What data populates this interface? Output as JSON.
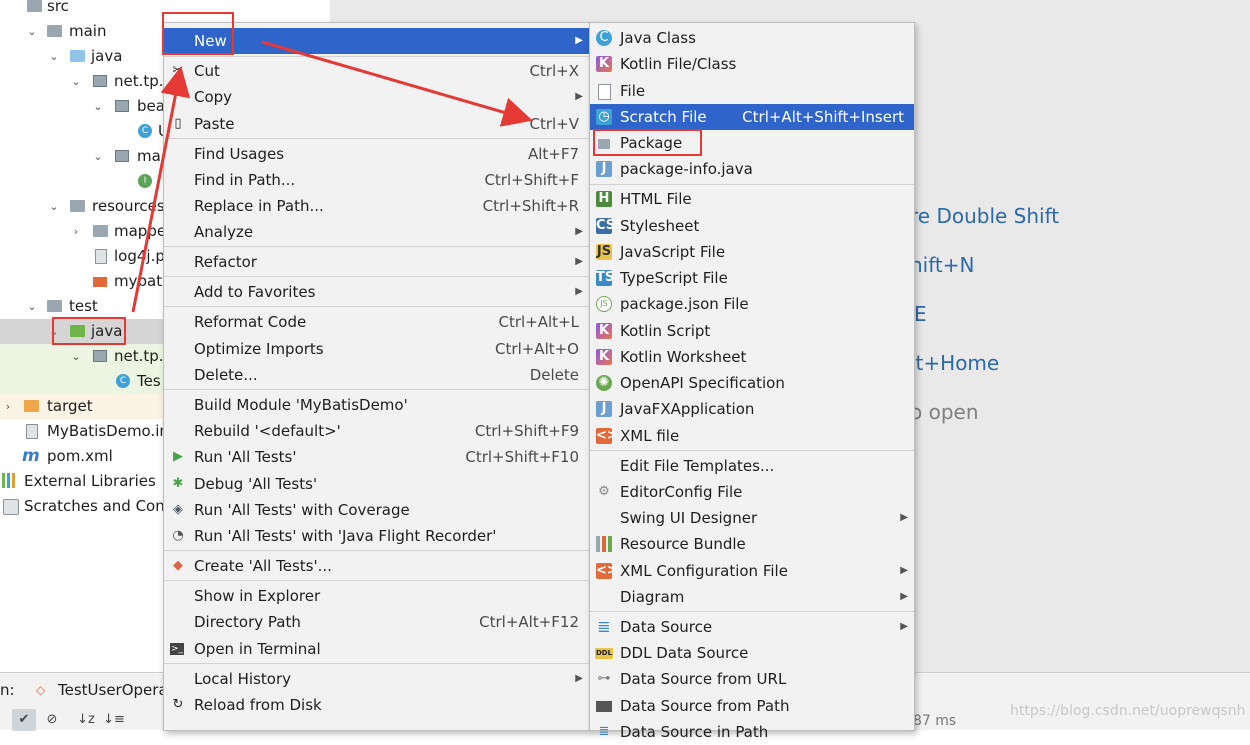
{
  "tree": {
    "rows": [
      {
        "label": "src",
        "indent": 0,
        "icon": "folder-grey",
        "chev": "⌄"
      },
      {
        "label": "main",
        "indent": 1,
        "icon": "folder-grey",
        "chev": "⌄"
      },
      {
        "label": "java",
        "indent": 2,
        "icon": "folder-blue",
        "chev": "⌄"
      },
      {
        "label": "net.tp.",
        "indent": 3,
        "icon": "pkg",
        "chev": "⌄"
      },
      {
        "label": "bea",
        "indent": 4,
        "icon": "pkg",
        "chev": "⌄"
      },
      {
        "label": "U",
        "indent": 5,
        "icon": "cls-c",
        "chev": ""
      },
      {
        "label": "ma",
        "indent": 4,
        "icon": "pkg",
        "chev": "⌄"
      },
      {
        "label": "",
        "indent": 5,
        "icon": "cls-i",
        "chev": ""
      },
      {
        "label": "resources",
        "indent": 2,
        "icon": "folder-grey",
        "chev": "⌄"
      },
      {
        "label": "mappe",
        "indent": 3,
        "icon": "folder-grey",
        "chev": "›"
      },
      {
        "label": "log4j.p",
        "indent": 3,
        "icon": "file-icon",
        "chev": ""
      },
      {
        "label": "mybati",
        "indent": 3,
        "icon": "xml-icon",
        "chev": ""
      },
      {
        "label": "test",
        "indent": 1,
        "icon": "folder-grey",
        "chev": "⌄"
      },
      {
        "label": "java",
        "indent": 2,
        "icon": "folder-green",
        "chev": "⌄"
      },
      {
        "label": "net.tp.",
        "indent": 3,
        "icon": "pkg",
        "chev": "⌄"
      },
      {
        "label": "Tes",
        "indent": 4,
        "icon": "cls-c",
        "chev": ""
      },
      {
        "label": "target",
        "indent": 0,
        "icon": "folder-orange",
        "chev": "›"
      },
      {
        "label": "MyBatisDemo.in",
        "indent": 0,
        "icon": "file-icon",
        "chev": ""
      },
      {
        "label": "pom.xml",
        "indent": 0,
        "icon": "maven",
        "chev": ""
      },
      {
        "label": "External Libraries",
        "indent": -1,
        "icon": "libs",
        "chev": ""
      },
      {
        "label": "Scratches and Cons",
        "indent": -1,
        "icon": "scratch",
        "chev": ""
      }
    ]
  },
  "editor_hints": {
    "h1": "re Double Shift",
    "h2": "hift+N",
    "h3": "E",
    "h4": "lt+Home",
    "h5": "o open"
  },
  "bottom": {
    "run_prefix": "n:",
    "run_tab": "TestUserOpera",
    "timing": "87 ms",
    "watermark": "https://blog.csdn.net/uoprewqsnh"
  },
  "context_menu": {
    "new": "New",
    "cut": "Cut",
    "cut_sc": "Ctrl+X",
    "copy": "Copy",
    "paste": "Paste",
    "paste_sc": "Ctrl+V",
    "find_usages": "Find Usages",
    "find_usages_sc": "Alt+F7",
    "find_in_path": "Find in Path...",
    "find_in_path_sc": "Ctrl+Shift+F",
    "replace_in_path": "Replace in Path...",
    "replace_in_path_sc": "Ctrl+Shift+R",
    "analyze": "Analyze",
    "refactor": "Refactor",
    "add_favorites": "Add to Favorites",
    "reformat": "Reformat Code",
    "reformat_sc": "Ctrl+Alt+L",
    "optimize": "Optimize Imports",
    "optimize_sc": "Ctrl+Alt+O",
    "delete": "Delete...",
    "delete_sc": "Delete",
    "build_module": "Build Module 'MyBatisDemo'",
    "rebuild": "Rebuild '<default>'",
    "rebuild_sc": "Ctrl+Shift+F9",
    "run_tests": "Run 'All Tests'",
    "run_tests_sc": "Ctrl+Shift+F10",
    "debug_tests": "Debug 'All Tests'",
    "run_coverage": "Run 'All Tests' with Coverage",
    "run_jfr": "Run 'All Tests' with 'Java Flight Recorder'",
    "create_tests": "Create 'All Tests'...",
    "show_explorer": "Show in Explorer",
    "directory_path": "Directory Path",
    "directory_path_sc": "Ctrl+Alt+F12",
    "open_terminal": "Open in Terminal",
    "local_history": "Local History",
    "reload": "Reload from Disk"
  },
  "submenu": {
    "java_class": "Java Class",
    "kotlin_file": "Kotlin File/Class",
    "file": "File",
    "scratch_file": "Scratch File",
    "scratch_file_sc": "Ctrl+Alt+Shift+Insert",
    "package": "Package",
    "package_info": "package-info.java",
    "html_file": "HTML File",
    "stylesheet": "Stylesheet",
    "js_file": "JavaScript File",
    "ts_file": "TypeScript File",
    "package_json": "package.json File",
    "kotlin_script": "Kotlin Script",
    "kotlin_worksheet": "Kotlin Worksheet",
    "openapi": "OpenAPI Specification",
    "javafx": "JavaFXApplication",
    "xml_file": "XML file",
    "edit_templates": "Edit File Templates...",
    "editorconfig": "EditorConfig File",
    "swing_designer": "Swing UI Designer",
    "resource_bundle": "Resource Bundle",
    "xml_config": "XML Configuration File",
    "diagram": "Diagram",
    "data_source": "Data Source",
    "ddl_data_source": "DDL Data Source",
    "ds_from_url": "Data Source from URL",
    "ds_from_path": "Data Source from Path",
    "ds_in_path": "Data Source in Path"
  },
  "colors": {
    "highlight": "#2f65ca",
    "annotation": "#e53935",
    "menu_bg": "#f2f2f2"
  }
}
